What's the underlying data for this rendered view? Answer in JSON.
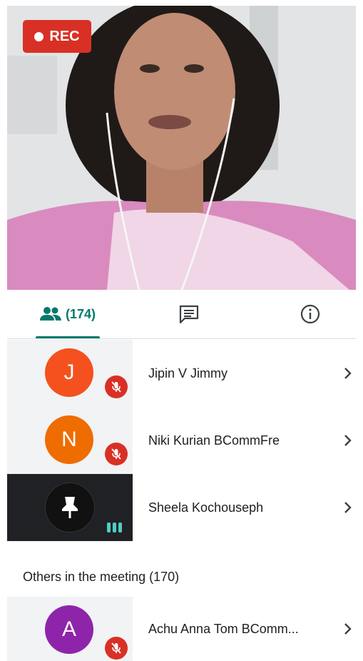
{
  "recording": {
    "label": "REC"
  },
  "tabs": {
    "people_count": "(174)",
    "people_icon": "people-icon",
    "chat_icon": "chat-icon",
    "info_icon": "info-icon"
  },
  "participants": [
    {
      "name": "Jipin V Jimmy",
      "initial": "J",
      "avatar_color": "#f4511e",
      "muted": true
    },
    {
      "name": "Niki Kurian BCommFre",
      "initial": "N",
      "avatar_color": "#ef6c00",
      "muted": true
    },
    {
      "name": "Sheela Kochouseph",
      "initial": "",
      "avatar_color": "#111111",
      "muted": false,
      "pinned": true,
      "speaking": true
    }
  ],
  "others": {
    "title": "Others in the meeting (170)",
    "participants": [
      {
        "name": "Achu Anna Tom BComm...",
        "initial": "A",
        "avatar_color": "#8e24aa",
        "muted": true
      }
    ]
  },
  "colors": {
    "accent": "#00796b",
    "rec": "#d93025",
    "muted": "#d93025"
  }
}
